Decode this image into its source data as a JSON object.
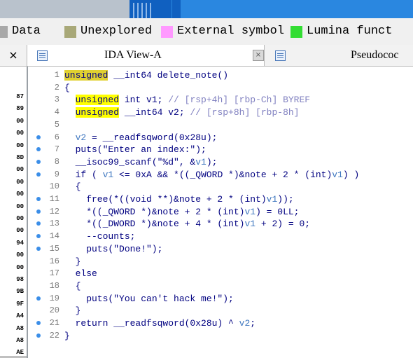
{
  "legend": {
    "items": [
      {
        "label": "Data",
        "color": "#a8a8a8"
      },
      {
        "label": "Unexplored",
        "color": "#a8a878"
      },
      {
        "label": "External symbol",
        "color": "#ff99ff"
      },
      {
        "label": "Lumina funct",
        "color": "#33dd33"
      }
    ]
  },
  "tabs": {
    "close_glyph": "×",
    "ida_title": "IDA View-A",
    "ida_close_glyph": "×",
    "pseudo_title": "Pseudococ"
  },
  "left_addresses": [
    "87",
    "89",
    "00",
    "00",
    "00",
    "8D",
    "00",
    "00",
    "00",
    "00",
    "00",
    "00",
    "94",
    "00",
    "00",
    "98",
    "9B",
    "9F",
    "A4",
    "A8",
    "A8",
    "AE"
  ],
  "code": {
    "lines": [
      {
        "n": "1",
        "dot": false,
        "segments": [
          {
            "t": "unsigned",
            "c": "sel"
          },
          {
            "t": " __int64 delete_note()",
            "c": ""
          }
        ]
      },
      {
        "n": "2",
        "dot": false,
        "segments": [
          {
            "t": "{",
            "c": ""
          }
        ]
      },
      {
        "n": "3",
        "dot": false,
        "segments": [
          {
            "t": "  ",
            "c": ""
          },
          {
            "t": "unsigned",
            "c": "kw"
          },
          {
            "t": " int v1; ",
            "c": ""
          },
          {
            "t": "// [rsp+4h] [rbp-Ch] BYREF",
            "c": "cm"
          }
        ]
      },
      {
        "n": "4",
        "dot": false,
        "segments": [
          {
            "t": "  ",
            "c": ""
          },
          {
            "t": "unsigned",
            "c": "kw"
          },
          {
            "t": " __int64 v2; ",
            "c": ""
          },
          {
            "t": "// [rsp+8h] [rbp-8h]",
            "c": "cm"
          }
        ]
      },
      {
        "n": "5",
        "dot": false,
        "segments": []
      },
      {
        "n": "6",
        "dot": true,
        "segments": [
          {
            "t": "  ",
            "c": ""
          },
          {
            "t": "v2",
            "c": "vr"
          },
          {
            "t": " = __readfsqword(0x28u);",
            "c": ""
          }
        ]
      },
      {
        "n": "7",
        "dot": true,
        "segments": [
          {
            "t": "  puts(\"Enter an index:\");",
            "c": ""
          }
        ]
      },
      {
        "n": "8",
        "dot": true,
        "segments": [
          {
            "t": "  __isoc99_scanf(\"%d\", &",
            "c": ""
          },
          {
            "t": "v1",
            "c": "vr"
          },
          {
            "t": ");",
            "c": ""
          }
        ]
      },
      {
        "n": "9",
        "dot": true,
        "segments": [
          {
            "t": "  if ( ",
            "c": ""
          },
          {
            "t": "v1",
            "c": "vr"
          },
          {
            "t": " <= 0xA && *((_QWORD *)&note + 2 * (int)",
            "c": ""
          },
          {
            "t": "v1",
            "c": "vr"
          },
          {
            "t": ") )",
            "c": ""
          }
        ]
      },
      {
        "n": "10",
        "dot": false,
        "segments": [
          {
            "t": "  {",
            "c": ""
          }
        ]
      },
      {
        "n": "11",
        "dot": true,
        "segments": [
          {
            "t": "    free(*((void **)&note + 2 * (int)",
            "c": ""
          },
          {
            "t": "v1",
            "c": "vr"
          },
          {
            "t": "));",
            "c": ""
          }
        ]
      },
      {
        "n": "12",
        "dot": true,
        "segments": [
          {
            "t": "    *((_QWORD *)&note + 2 * (int)",
            "c": ""
          },
          {
            "t": "v1",
            "c": "vr"
          },
          {
            "t": ") = 0LL;",
            "c": ""
          }
        ]
      },
      {
        "n": "13",
        "dot": true,
        "segments": [
          {
            "t": "    *((_DWORD *)&note + 4 * (int)",
            "c": ""
          },
          {
            "t": "v1",
            "c": "vr"
          },
          {
            "t": " + 2) = 0;",
            "c": ""
          }
        ]
      },
      {
        "n": "14",
        "dot": true,
        "segments": [
          {
            "t": "    --counts;",
            "c": ""
          }
        ]
      },
      {
        "n": "15",
        "dot": true,
        "segments": [
          {
            "t": "    puts(\"Done!\");",
            "c": ""
          }
        ]
      },
      {
        "n": "16",
        "dot": false,
        "segments": [
          {
            "t": "  }",
            "c": ""
          }
        ]
      },
      {
        "n": "17",
        "dot": false,
        "segments": [
          {
            "t": "  else",
            "c": ""
          }
        ]
      },
      {
        "n": "18",
        "dot": false,
        "segments": [
          {
            "t": "  {",
            "c": ""
          }
        ]
      },
      {
        "n": "19",
        "dot": true,
        "segments": [
          {
            "t": "    puts(\"You can't hack me!\");",
            "c": ""
          }
        ]
      },
      {
        "n": "20",
        "dot": false,
        "segments": [
          {
            "t": "  }",
            "c": ""
          }
        ]
      },
      {
        "n": "21",
        "dot": true,
        "segments": [
          {
            "t": "  return __readfsqword(0x28u) ^ ",
            "c": ""
          },
          {
            "t": "v2",
            "c": "vr"
          },
          {
            "t": ";",
            "c": ""
          }
        ]
      },
      {
        "n": "22",
        "dot": true,
        "segments": [
          {
            "t": "}",
            "c": ""
          }
        ]
      }
    ]
  }
}
